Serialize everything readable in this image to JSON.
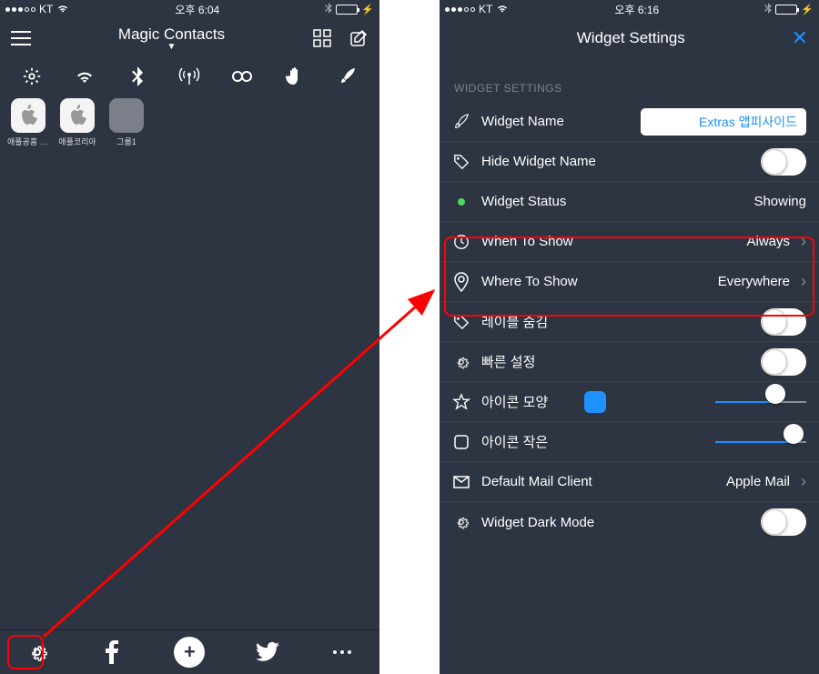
{
  "left": {
    "status": {
      "carrier": "KT",
      "time": "오후 6:04"
    },
    "nav": {
      "title": "Magic Contacts"
    },
    "apps": [
      {
        "label": "애플공홈 주…"
      },
      {
        "label": "애플코리아"
      },
      {
        "label": "그룹1"
      }
    ]
  },
  "right": {
    "status": {
      "carrier": "KT",
      "time": "오후 6:16"
    },
    "nav": {
      "title": "Widget Settings"
    },
    "section_header": "WIDGET SETTINGS",
    "rows": {
      "widget_name": {
        "label": "Widget Name",
        "value": "Extras 앱피사이드"
      },
      "hide_name": {
        "label": "Hide Widget Name"
      },
      "status": {
        "label": "Widget Status",
        "value": "Showing"
      },
      "when": {
        "label": "When To Show",
        "value": "Always"
      },
      "where": {
        "label": "Where To Show",
        "value": "Everywhere"
      },
      "hide_label": {
        "label": "레이블 숨김"
      },
      "quick": {
        "label": "빠른 설정"
      },
      "icon_shape": {
        "label": "아이콘 모양"
      },
      "icon_small": {
        "label": "아이콘 작은"
      },
      "mail": {
        "label": "Default Mail Client",
        "value": "Apple Mail"
      },
      "dark": {
        "label": "Widget Dark Mode"
      }
    }
  }
}
